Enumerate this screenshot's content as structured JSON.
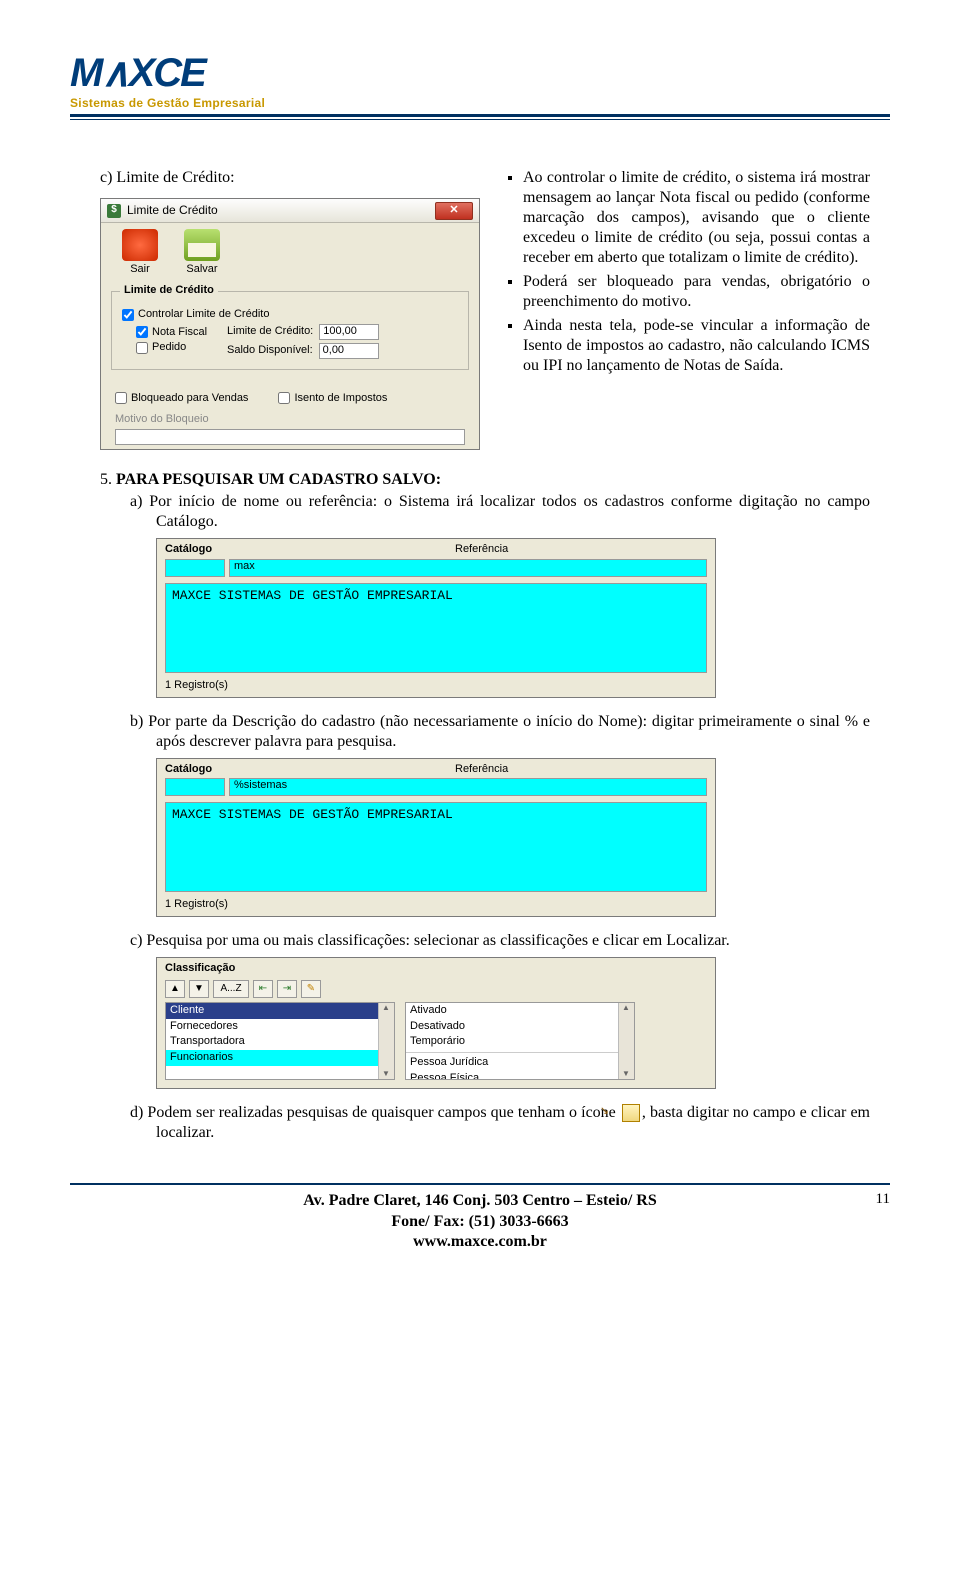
{
  "header": {
    "logo_text": "MAXCE",
    "logo_sub": "Sistemas de Gestão Empresarial"
  },
  "intro": {
    "c_label": "c)  Limite de Crédito:"
  },
  "dialog": {
    "title": "Limite de Crédito",
    "btn_sair": "Sair",
    "btn_salvar": "Salvar",
    "group_title": "Limite de Crédito",
    "chk_controlar": "Controlar Limite de Crédito",
    "chk_nota": "Nota Fiscal",
    "chk_pedido": "Pedido",
    "lbl_limite": "Limite de Crédito:",
    "val_limite": "100,00",
    "lbl_saldo": "Saldo Disponível:",
    "val_saldo": "0,00",
    "chk_bloqueado": "Bloqueado para Vendas",
    "chk_isento": "Isento de Impostos",
    "lbl_motivo": "Motivo do Bloqueio"
  },
  "bullets": {
    "b1": "Ao controlar o limite de crédito, o sistema irá mostrar mensagem ao lançar Nota fiscal ou pedido (conforme marcação dos campos), avisando que o cliente excedeu o limite de crédito (ou seja, possui contas a receber em aberto que totalizam o limite de crédito).",
    "b2": "Poderá ser bloqueado para vendas, obrigatório o preenchimento do motivo.",
    "b3": "Ainda nesta tela, pode-se vincular a informação de Isento de impostos ao cadastro, não calculando ICMS ou IPI no lançamento de Notas de Saída."
  },
  "sec5": {
    "num": "5.",
    "head": "PARA PESQUISAR UM CADASTRO SALVO:",
    "a": "a)   Por início de nome ou referência: o Sistema irá localizar todos os cadastros conforme digitação no campo Catálogo.",
    "b": "b)   Por parte da Descrição do cadastro (não necessariamente o início do Nome): digitar primeiramente o sinal % e após descrever palavra para pesquisa.",
    "c": "c)   Pesquisa por uma ou mais classificações: selecionar as classificações e clicar em Localizar.",
    "d_pre": "d)  Podem ser realizadas pesquisas de quaisquer campos que tenham o ícone ",
    "d_post": ", basta digitar no campo e clicar em localizar."
  },
  "catalog1": {
    "label": "Catálogo",
    "ref": "Referência",
    "term": "max",
    "result": "MAXCE SISTEMAS DE GESTÃO EMPRESARIAL",
    "count": "1 Registro(s)"
  },
  "catalog2": {
    "label": "Catálogo",
    "ref": "Referência",
    "term": "%sistemas",
    "result": "MAXCE SISTEMAS DE GESTÃO EMPRESARIAL",
    "count": "1 Registro(s)"
  },
  "classif": {
    "label": "Classificação",
    "sort": "A...Z",
    "left": [
      "Cliente",
      "Fornecedores",
      "Transportadora",
      "Funcionarios"
    ],
    "right_top": [
      "Ativado",
      "Desativado",
      "Temporário"
    ],
    "right_bot": [
      "Pessoa Jurídica",
      "Pessoa Física"
    ]
  },
  "footer": {
    "l1": "Av. Padre Claret, 146 Conj. 503 Centro – Esteio/ RS",
    "l2": "Fone/ Fax: (51) 3033-6663",
    "l3": "www.maxce.com.br",
    "page": "11"
  }
}
